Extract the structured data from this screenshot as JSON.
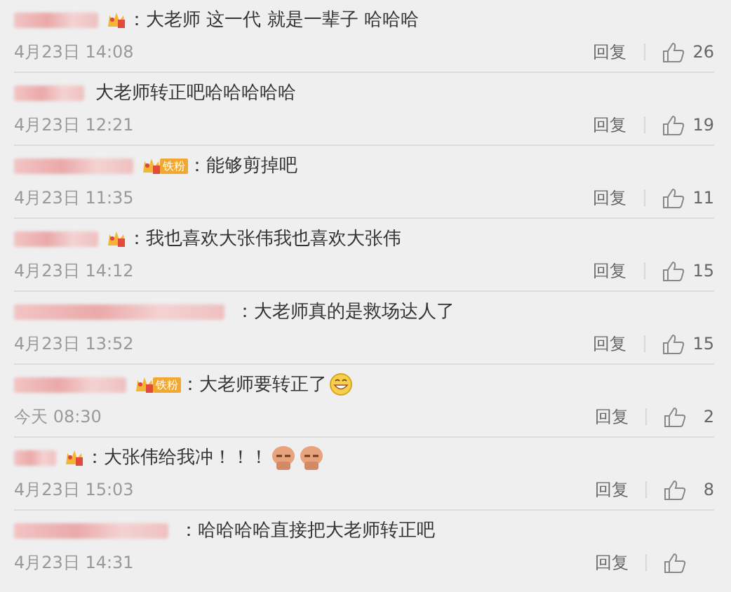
{
  "comments": [
    {
      "badge": {
        "kind": "crown"
      },
      "text": "：大老师 这一代 就是一辈子 哈哈哈",
      "time": "4月23日 14:08",
      "reply": "回复",
      "likes": "26"
    },
    {
      "text": "大老师转正吧哈哈哈哈哈",
      "time": "4月23日 12:21",
      "reply": "回复",
      "likes": "19"
    },
    {
      "badge": {
        "kind": "crown",
        "fan_label": "铁粉"
      },
      "text": "：能够剪掉吧",
      "time": "4月23日 11:35",
      "reply": "回复",
      "likes": "11"
    },
    {
      "badge": {
        "kind": "crown"
      },
      "text": "：我也喜欢大张伟我也喜欢大张伟",
      "time": "4月23日 14:12",
      "reply": "回复",
      "likes": "15"
    },
    {
      "text": "：大老师真的是救场达人了",
      "time": "4月23日 13:52",
      "reply": "回复",
      "likes": "15"
    },
    {
      "badge": {
        "kind": "crown",
        "fan_label": "铁粉"
      },
      "text": "：大老师要转正了",
      "emojis": [
        {
          "kind": "grin"
        }
      ],
      "time": "今天 08:30",
      "reply": "回复",
      "likes": "2"
    },
    {
      "badge": {
        "kind": "crown"
      },
      "text": "：大张伟给我冲！！！",
      "emojis": [
        {
          "kind": "sticker"
        },
        {
          "kind": "sticker"
        }
      ],
      "time": "4月23日 15:03",
      "reply": "回复",
      "likes": "8"
    },
    {
      "text": "：哈哈哈哈直接把大老师转正吧",
      "time": "4月23日 14:31",
      "reply": "回复"
    }
  ]
}
